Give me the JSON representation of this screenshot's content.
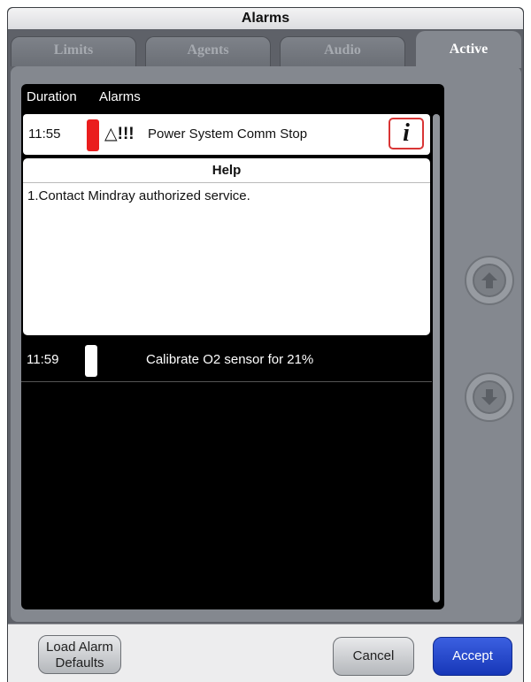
{
  "window": {
    "title": "Alarms"
  },
  "tabs": [
    {
      "label": "Limits",
      "active": false
    },
    {
      "label": "Agents",
      "active": false
    },
    {
      "label": "Audio",
      "active": false
    },
    {
      "label": "Active",
      "active": true
    }
  ],
  "list": {
    "header": {
      "col_duration": "Duration",
      "col_alarms": "Alarms"
    },
    "alarms": [
      {
        "time": "11:55",
        "priority_color": "#ea1d1d",
        "priority_mark": "△!!!",
        "message": "Power System Comm Stop",
        "info_label": "i"
      },
      {
        "time": "11:59",
        "priority_color": "#ffffff",
        "message": "Calibrate O2 sensor for 21%"
      }
    ],
    "help": {
      "title": "Help",
      "text": "1.Contact Mindray authorized service."
    }
  },
  "scroll": {
    "up_icon": "arrow-up-icon",
    "down_icon": "arrow-down-icon"
  },
  "footer": {
    "load_defaults_line1": "Load Alarm",
    "load_defaults_line2": "Defaults",
    "cancel": "Cancel",
    "accept": "Accept"
  },
  "colors": {
    "accent": "#1f44c9",
    "panel": "#84888f",
    "alarm_high": "#ea1d1d"
  }
}
